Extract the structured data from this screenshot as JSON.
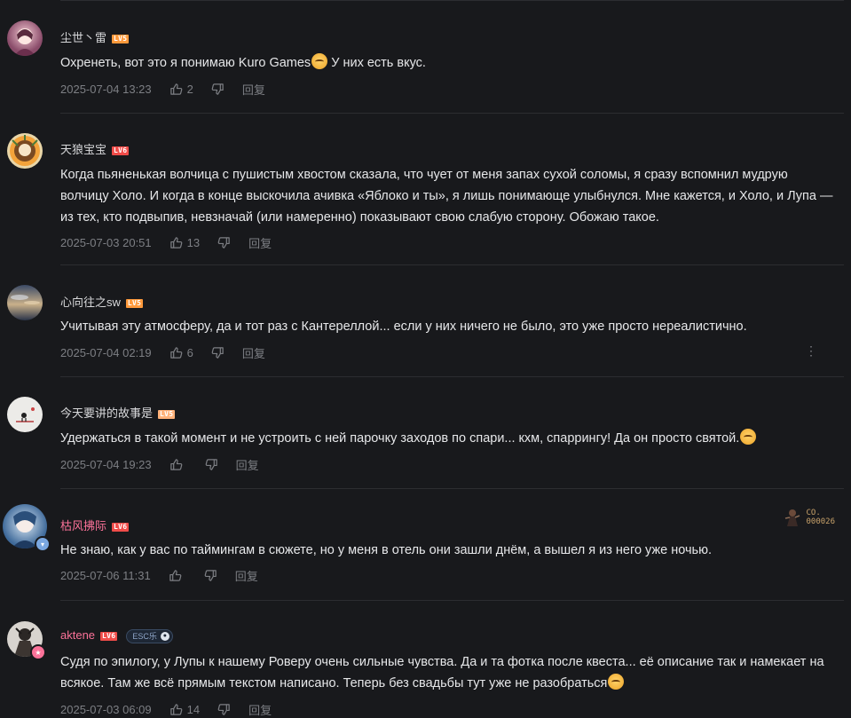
{
  "comments": [
    {
      "username": "尘世丶雷",
      "level": "LV5",
      "text": "Охренеть, вот это я понимаю Kuro Games",
      "text_after": " У них есть вкус.",
      "time": "2025-07-04 13:23",
      "likes": "2",
      "reply": "回复"
    },
    {
      "username": "天狼宝宝",
      "level": "LV6",
      "text": "Когда пьяненькая волчица с пушистым хвостом сказала, что чует от меня запах сухой соломы, я сразу вспомнил мудрую волчицу Холо. И когда в конце выскочила ачивка «Яблоко и ты», я лишь понимающе улыбнулся. Мне кажется, и Холо, и Лупа — из тех, кто подвыпив, невзначай (или намеренно) показывают свою слабую сторону. Обожаю такое.",
      "time": "2025-07-03 20:51",
      "likes": "13",
      "reply": "回复"
    },
    {
      "username": "心向往之sw",
      "level": "LV5",
      "text": "Учитывая эту атмосферу, да и тот раз с Кантереллой... если у них ничего не было, это уже просто нереалистично.",
      "time": "2025-07-04 02:19",
      "likes": "6",
      "reply": "回复",
      "more": "⋮"
    },
    {
      "username": "今天要讲的故事是",
      "level": "LV5",
      "text": "Удержаться в такой момент и не устроить с ней парочку заходов по спари... кхм, спаррингу! Да он просто святой.",
      "time": "2025-07-04 19:23",
      "likes": "",
      "reply": "回复"
    },
    {
      "username": "枯风拂际",
      "level": "LV6",
      "text": "Не знаю, как у вас по таймингам в сюжете, но у меня в отель они зашли днём, а вышел я из него уже ночью.",
      "time": "2025-07-06 11:31",
      "likes": "",
      "reply": "回复",
      "fan_badge_line1": "CO.",
      "fan_badge_line2": "000026"
    },
    {
      "username": "aktene",
      "level": "LV6",
      "badge": "ESC乐",
      "text": "Судя по эпилогу, у Лупы к нашему Роверу очень сильные чувства. Да и та фотка после квеста... её описание так и намекает на всякое. Там же всё прямым текстом написано. Теперь без свадьбы тут уже не разобраться",
      "time": "2025-07-03 06:09",
      "likes": "14",
      "reply": "回复"
    }
  ],
  "colors": {
    "background": "#18191c",
    "username_vip": "#fb7299",
    "meta": "#7d7f84",
    "level5": "#ff9a3c",
    "level6": "#f04c49"
  }
}
